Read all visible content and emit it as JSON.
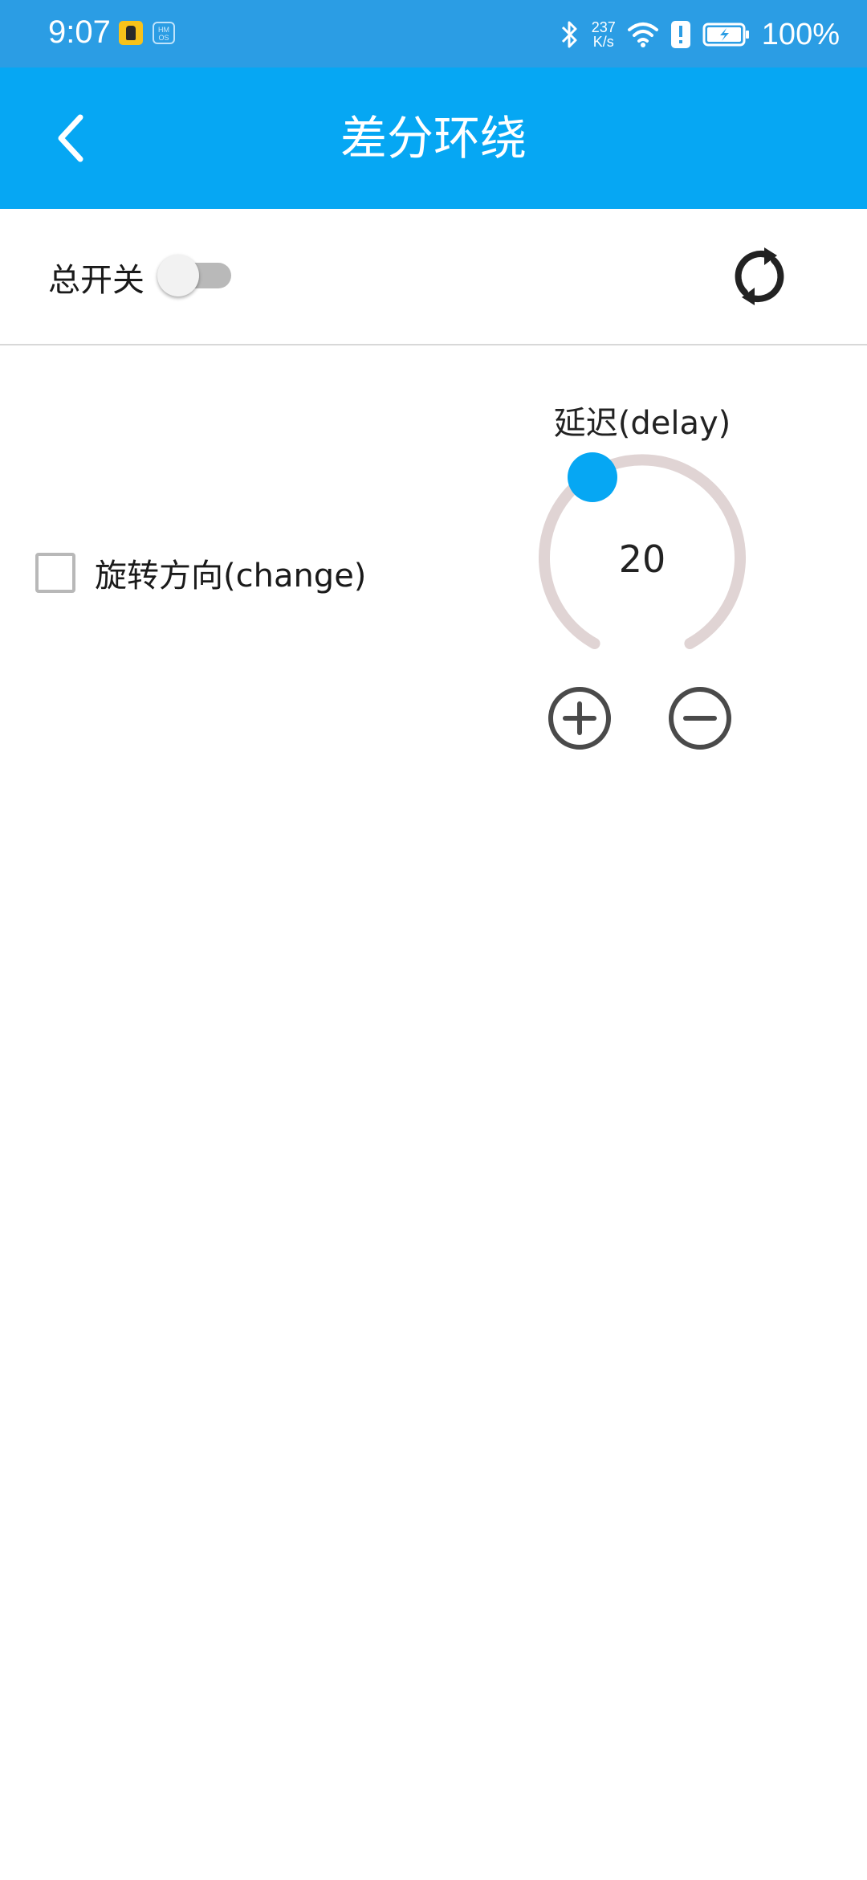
{
  "status_bar": {
    "time": "9:07",
    "hmos_badge": "HM OS",
    "net_speed_value": "237",
    "net_speed_unit": "K/s",
    "battery": "100%"
  },
  "header": {
    "title": "差分环绕",
    "back_icon": "chevron-left-icon"
  },
  "controls": {
    "master_switch_label": "总开关",
    "master_switch_on": false,
    "refresh_icon": "refresh-icon",
    "rotate_direction_label": "旋转方向(change)",
    "rotate_direction_checked": false
  },
  "delay": {
    "label": "延迟(delay)",
    "value": "20",
    "increase_icon": "plus-circle-icon",
    "decrease_icon": "minus-circle-icon"
  },
  "colors": {
    "status_bar": "#2b9de4",
    "app_bar": "#06a7f3",
    "accent": "#06a7f3",
    "knob_track": "#e0d4d4"
  }
}
